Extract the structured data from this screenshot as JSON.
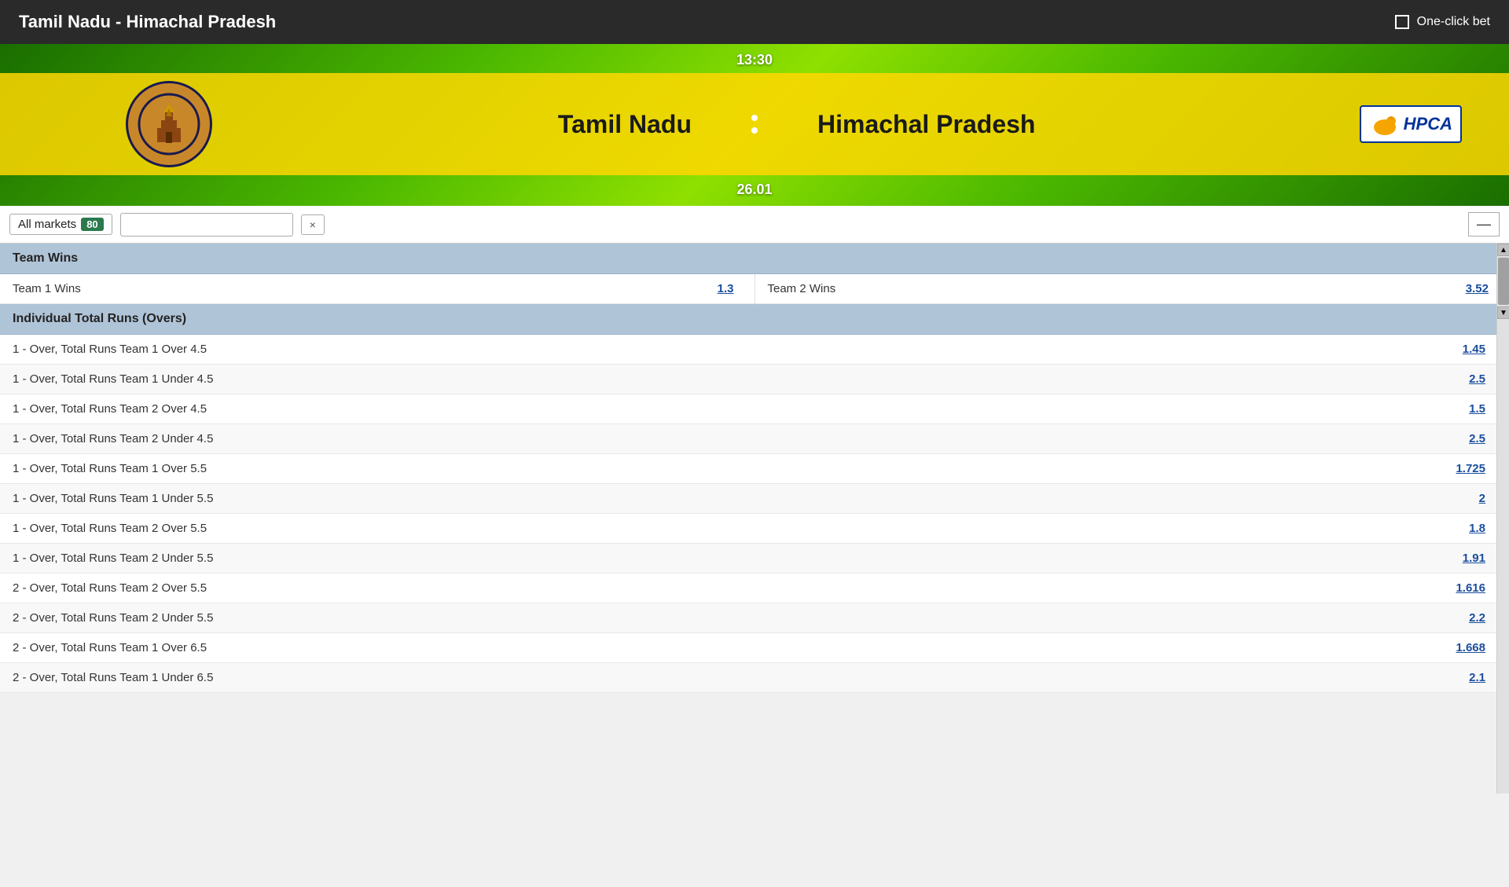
{
  "header": {
    "title": "Tamil Nadu - Himachal Pradesh",
    "one_click_label": "One-click bet"
  },
  "banner": {
    "time": "13:30",
    "score": "26.01",
    "team1": {
      "name": "Tamil Nadu"
    },
    "team2": {
      "name": "Himachal Pradesh"
    }
  },
  "markets_bar": {
    "label": "All markets",
    "count": "80",
    "search_placeholder": "",
    "clear_label": "×"
  },
  "sections": [
    {
      "title": "Team Wins",
      "type": "two-column",
      "rows": [
        {
          "team1_name": "Team 1 Wins",
          "team1_odds": "1.3",
          "team2_name": "Team 2 Wins",
          "team2_odds": "3.52"
        }
      ]
    },
    {
      "title": "Individual Total Runs (Overs)",
      "type": "single-column",
      "rows": [
        {
          "name": "1 - Over, Total Runs Team 1 Over 4.5",
          "odds": "1.45"
        },
        {
          "name": "1 - Over, Total Runs Team 1 Under 4.5",
          "odds": "2.5"
        },
        {
          "name": "1 - Over, Total Runs Team 2 Over 4.5",
          "odds": "1.5"
        },
        {
          "name": "1 - Over, Total Runs Team 2 Under 4.5",
          "odds": "2.5"
        },
        {
          "name": "1 - Over, Total Runs Team 1 Over 5.5",
          "odds": "1.725"
        },
        {
          "name": "1 - Over, Total Runs Team 1 Under 5.5",
          "odds": "2"
        },
        {
          "name": "1 - Over, Total Runs Team 2 Over 5.5",
          "odds": "1.8"
        },
        {
          "name": "1 - Over, Total Runs Team 2 Under 5.5",
          "odds": "1.91"
        },
        {
          "name": "2 - Over, Total Runs Team 2 Over 5.5",
          "odds": "1.616"
        },
        {
          "name": "2 - Over, Total Runs Team 2 Under 5.5",
          "odds": "2.2"
        },
        {
          "name": "2 - Over, Total Runs Team 1 Over 6.5",
          "odds": "1.668"
        },
        {
          "name": "2 - Over, Total Runs Team 1 Under 6.5",
          "odds": "2.1"
        }
      ]
    }
  ]
}
